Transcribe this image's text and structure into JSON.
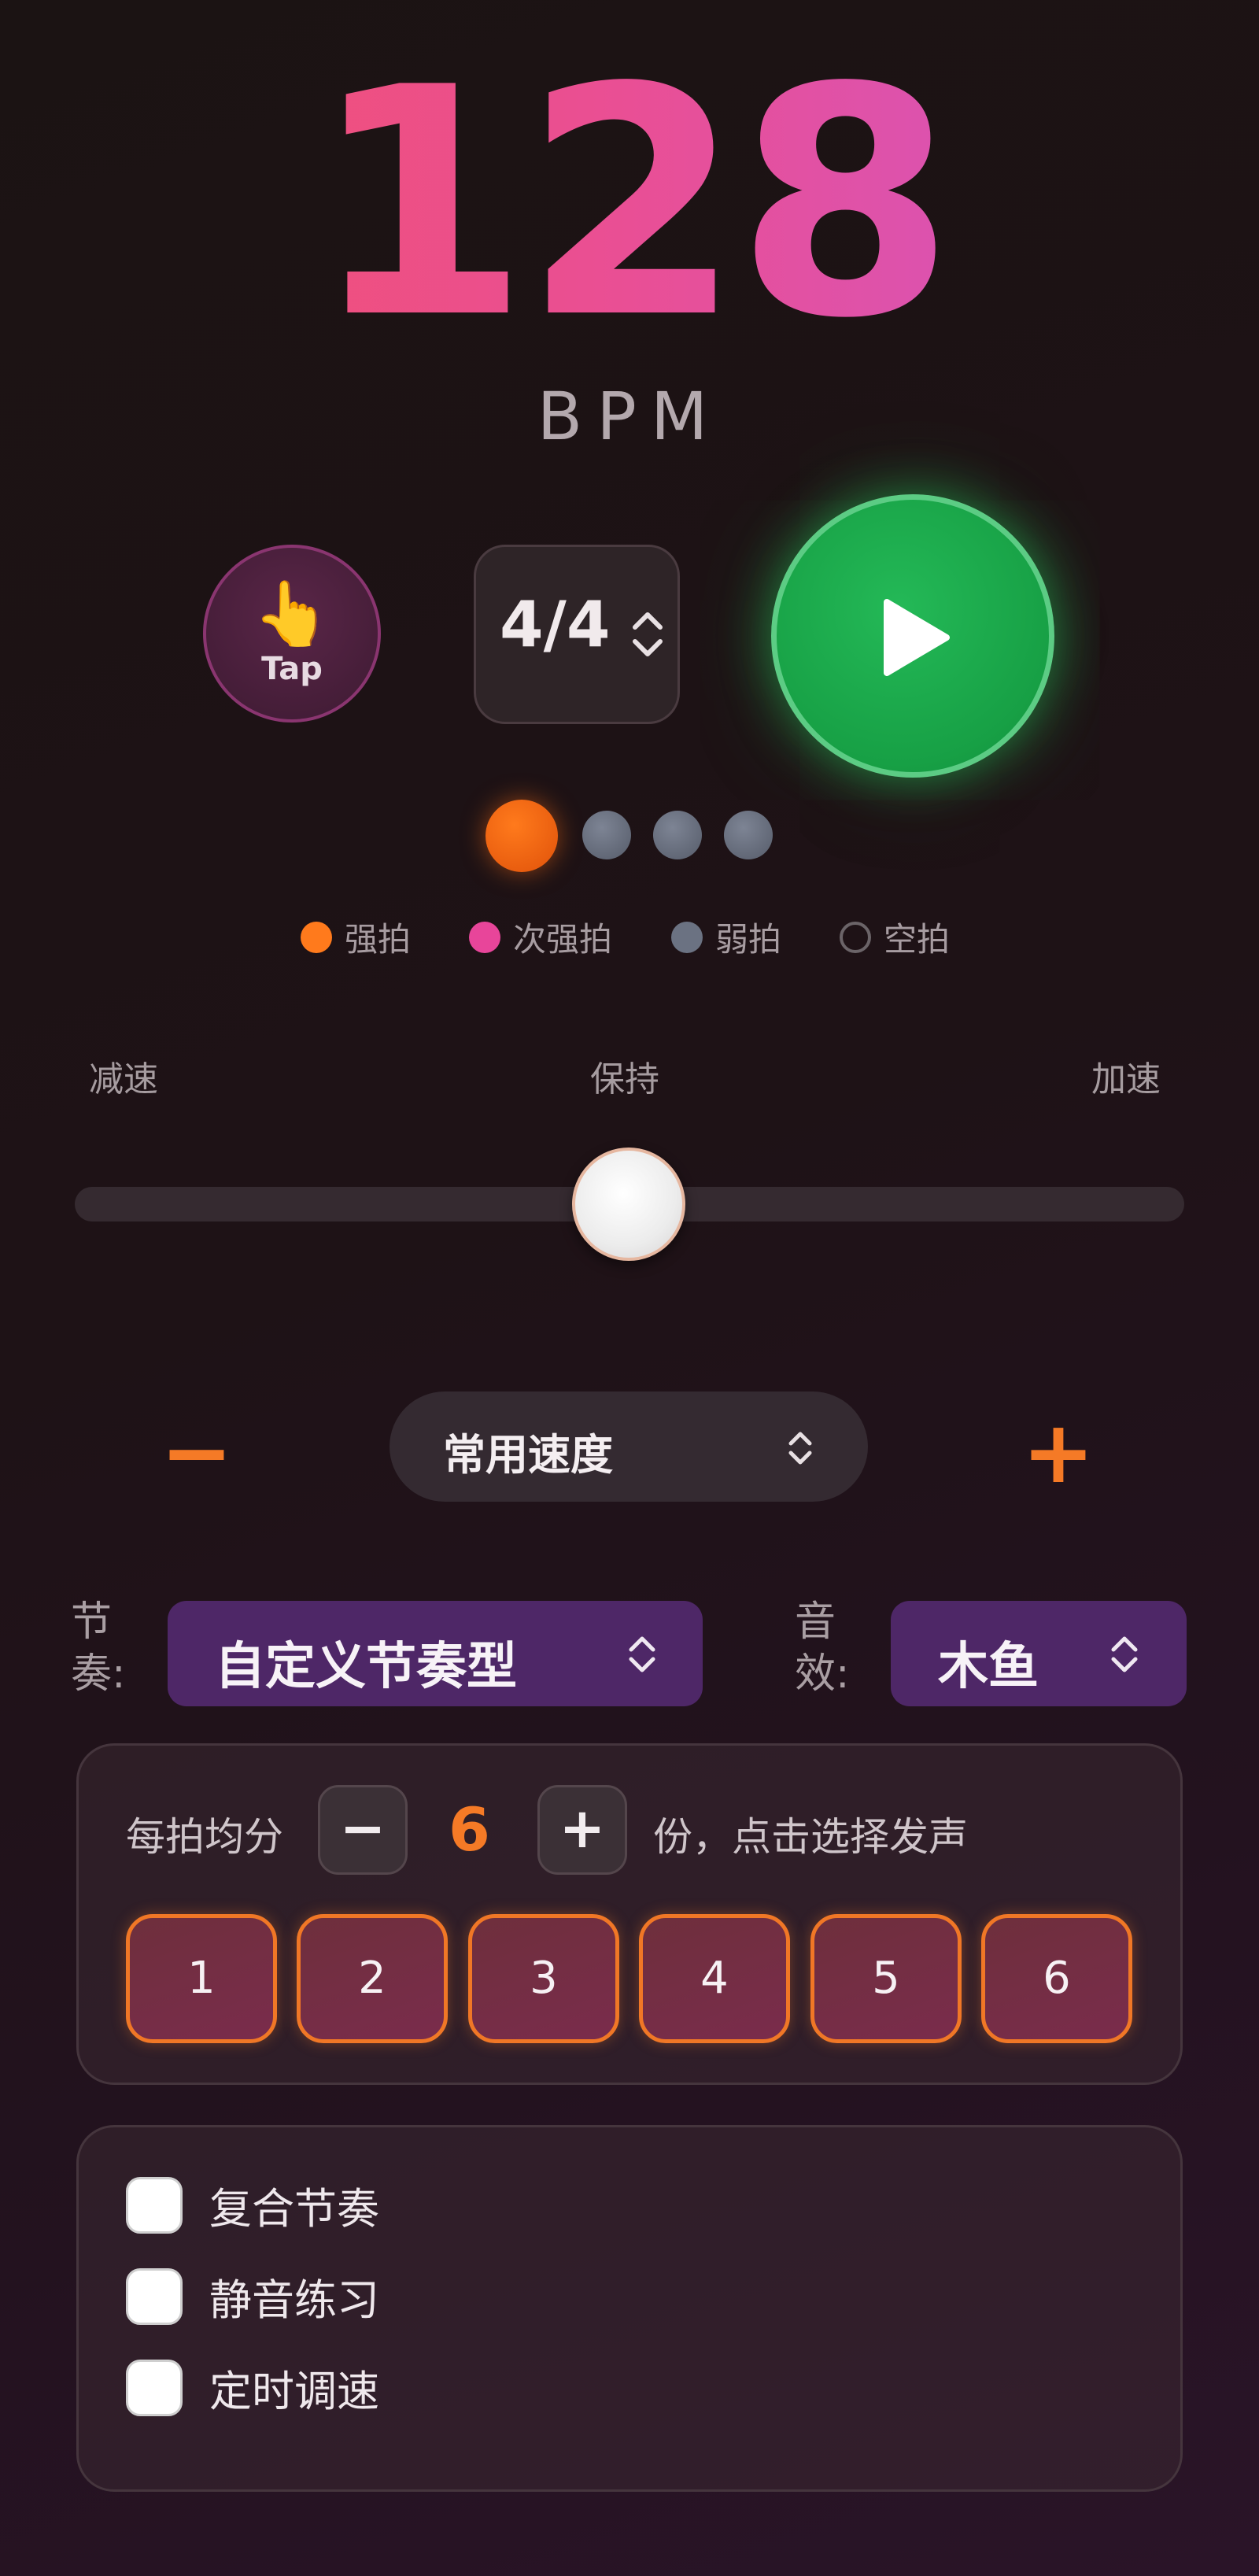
{
  "bpm": {
    "value": "128",
    "unit": "BPM"
  },
  "controls": {
    "tap_label": "Tap",
    "tap_icon": "👆",
    "time_signature": "4/4",
    "play_icon": "play-icon"
  },
  "beats": {
    "count": 4,
    "accent_index": 0
  },
  "legend": [
    {
      "label": "强拍",
      "color": "#ff7a1c"
    },
    {
      "label": "次强拍",
      "color": "#e8459a"
    },
    {
      "label": "弱拍",
      "color": "#6b7282"
    },
    {
      "label": "空拍",
      "color": "hollow"
    }
  ],
  "speed": {
    "left_label": "减速",
    "center_label": "保持",
    "right_label": "加速",
    "value": 0.5
  },
  "preset": {
    "minus": "−",
    "label": "常用速度",
    "plus": "+"
  },
  "rhythm": {
    "label": "节奏:",
    "value": "自定义节奏型"
  },
  "sound": {
    "label": "音效:",
    "value": "木鱼"
  },
  "subdivision": {
    "prefix": "每拍均分",
    "minus": "−",
    "count": "6",
    "plus": "+",
    "suffix": "份，点击选择发声",
    "pads": [
      "1",
      "2",
      "3",
      "4",
      "5",
      "6"
    ]
  },
  "options": [
    {
      "label": "复合节奏",
      "checked": false
    },
    {
      "label": "静音练习",
      "checked": false
    },
    {
      "label": "定时调速",
      "checked": false
    }
  ]
}
